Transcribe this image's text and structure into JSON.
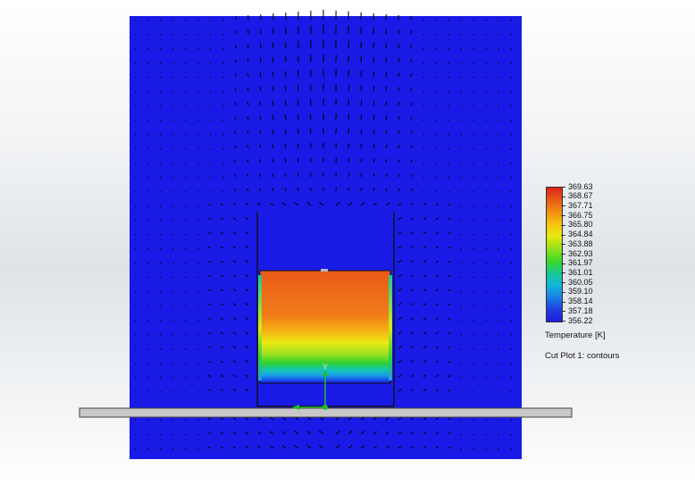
{
  "legend": {
    "ticks": [
      "369.63",
      "368.67",
      "367.71",
      "366.75",
      "365.80",
      "364.84",
      "363.88",
      "362.93",
      "361.97",
      "361.01",
      "360.05",
      "359.10",
      "358.14",
      "357.18",
      "356.22"
    ],
    "colors": [
      "#e0221b",
      "#e85a15",
      "#f08d13",
      "#f6c20e",
      "#e8ea0f",
      "#9ae21c",
      "#3cd82a",
      "#15c893",
      "#12b7d9",
      "#1a7fe8",
      "#1f3fe2",
      "#1d1ee0"
    ],
    "title": "Temperature [K]"
  },
  "caption": "Cut Plot 1: contours",
  "axis_label": "Y",
  "colors": {
    "domain_blue": "#1a1ae6",
    "vector": "#000000",
    "plate": "#c8c8c8",
    "axis_green": "#1fbf2a"
  }
}
